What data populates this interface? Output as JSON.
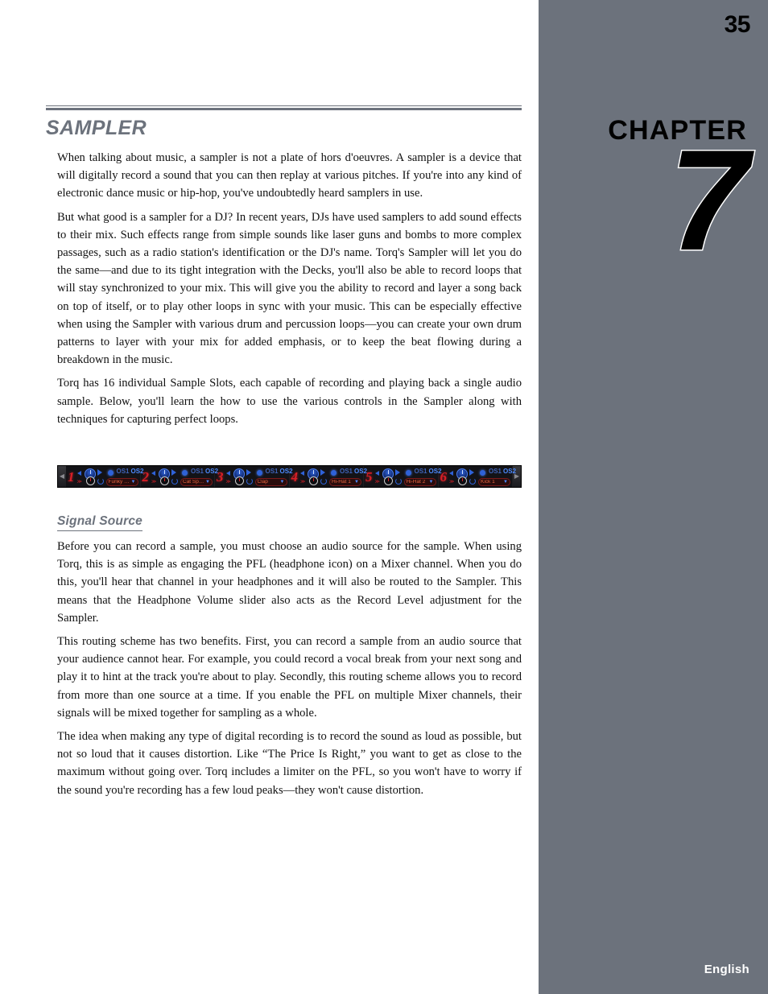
{
  "page": {
    "number": "35",
    "language_footer": "English",
    "accent_gray": "#6c727c",
    "background": "#ffffff"
  },
  "sidebar": {
    "chapter_word": "CHAPTER",
    "chapter_number": "7"
  },
  "section": {
    "title": "SAMPLER",
    "paragraphs": [
      "When talking about music, a sampler is not a plate of hors d'oeuvres. A sampler is a device that will digitally record a sound that you can then replay at various pitches. If you're into any kind of electronic dance music or hip-hop, you've undoubtedly heard samplers in use.",
      "But what good is a sampler for a DJ? In recent years, DJs have used samplers to add sound effects to their mix. Such effects range from simple sounds like laser guns and bombs to more complex passages, such as a radio station's identification or the DJ's name. Torq's Sampler will let you do the same—and due to its tight integration with the Decks, you'll also be able to record loops that will stay synchronized to your mix. This will give you the ability to record and layer a song back on top of itself, or to play other loops in sync with your music. This can be especially effective when using the Sampler with various drum and percussion loops—you can create your own drum patterns to layer with your mix for added emphasis, or to keep the beat flowing during a breakdown in the music.",
      "Torq has 16 individual Sample Slots, each capable of recording and playing back a single audio sample. Below, you'll learn the how to use the various controls in the Sampler along with techniques for capturing perfect loops."
    ]
  },
  "sampler_figure": {
    "caption": "",
    "left_arrow": "◀",
    "right_arrow": "▶",
    "slots": [
      {
        "number": "1",
        "os1": "OS1",
        "os2": "OS2",
        "sample_name": "Funky Dru..."
      },
      {
        "number": "2",
        "os1": "OS1",
        "os2": "OS2",
        "sample_name": "Cat Spacesh"
      },
      {
        "number": "3",
        "os1": "OS1",
        "os2": "OS2",
        "sample_name": "Clap"
      },
      {
        "number": "4",
        "os1": "OS1",
        "os2": "OS2",
        "sample_name": "Hi-Hat 1"
      },
      {
        "number": "5",
        "os1": "OS1",
        "os2": "OS2",
        "sample_name": "Hi-Hat 2"
      },
      {
        "number": "6",
        "os1": "OS1",
        "os2": "OS2",
        "sample_name": "Kick 1"
      }
    ]
  },
  "subsection": {
    "title": "Signal Source",
    "paragraphs": [
      "Before you can record a sample, you must choose an audio source for the sample. When using Torq, this is as simple as engaging the PFL (headphone icon) on a Mixer channel. When you do this, you'll hear that channel in your headphones and it will also be routed to the Sampler. This means that the Headphone Volume slider also acts as the Record Level adjustment for the Sampler.",
      "This routing scheme has two benefits. First, you can record a sample from an audio source that your audience cannot hear. For example, you could record a vocal break from your next song and play it to hint at the track you're about to play. Secondly, this routing scheme allows you to record from more than one source at a time. If you enable the PFL on multiple Mixer channels, their signals will be mixed together for sampling as a whole.",
      "The idea when making any type of digital recording is to record the sound as loud as possible, but not so loud that it causes distortion. Like “The Price Is Right,” you want to get as close to the maximum without going over. Torq includes a limiter on the PFL, so you won't have to worry if the sound you're recording has a few loud peaks—they won't cause distortion."
    ]
  }
}
